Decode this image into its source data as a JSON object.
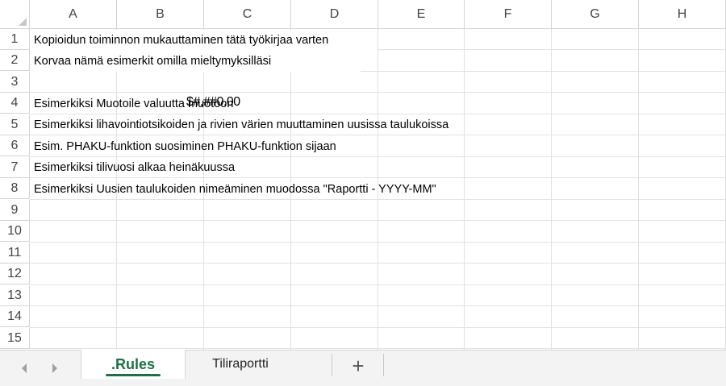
{
  "columns": [
    "A",
    "B",
    "C",
    "D",
    "E",
    "F",
    "G",
    "H"
  ],
  "rows": [
    "1",
    "2",
    "3",
    "4",
    "5",
    "6",
    "7",
    "8",
    "9",
    "10",
    "11",
    "12",
    "13",
    "14",
    "15"
  ],
  "cells": {
    "r1": "Kopioidun toiminnon mukauttaminen tätä työkirjaa varten",
    "r2": "Korvaa nämä esimerkit omilla mieltymyksilläsi",
    "r4": "Esimerkiksi Muotoile valuutta muotoon",
    "r4_overlay": "$#,##0.00",
    "r5": "Esimerkiksi lihavointiotsikoiden ja rivien värien muuttaminen uusissa taulukoissa",
    "r6": "Esim. PHAKU-funktion suosiminen PHAKU-funktion sijaan",
    "r7": "Esimerkiksi tilivuosi alkaa heinäkuussa",
    "r8": "Esimerkiksi Uusien taulukoiden nimeäminen muodossa \"Raportti - YYYY-MM\""
  },
  "tabs": {
    "nav_prev_icon": "chevron-left-icon",
    "nav_next_icon": "chevron-right-icon",
    "sheet1": ".Rules",
    "sheet2": "Tiliraportti",
    "add_label": "+"
  },
  "colors": {
    "active_tab": "#1e7145",
    "gridline": "#e1e1e1",
    "header_border": "#d4d4d4"
  }
}
